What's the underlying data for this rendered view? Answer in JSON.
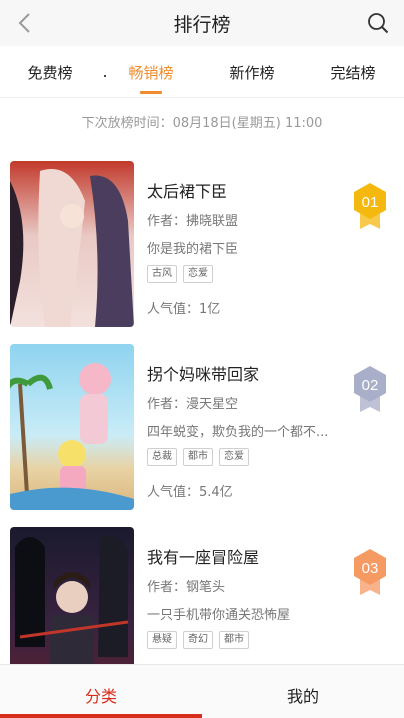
{
  "header": {
    "title": "排行榜",
    "back_icon": "chevron-left-icon",
    "search_icon": "search-icon"
  },
  "tabs": [
    {
      "label": "免费榜",
      "active": false
    },
    {
      "label": "畅销榜",
      "active": true
    },
    {
      "label": "新作榜",
      "active": false
    },
    {
      "label": "完结榜",
      "active": false
    }
  ],
  "schedule_text": "下次放榜时间：08月18日(星期五) 11:00",
  "items": [
    {
      "rank": "01",
      "title": "太后裙下臣",
      "author": "作者：拂晓联盟",
      "description": "你是我的裙下臣",
      "tags": [
        "古风",
        "恋爱"
      ],
      "popularity": "人气值：1亿",
      "badge_color": "#f5b80f"
    },
    {
      "rank": "02",
      "title": "拐个妈咪带回家",
      "author": "作者：漫天星空",
      "description": "四年蜕变，欺负我的一个都不...",
      "tags": [
        "总裁",
        "都市",
        "恋爱"
      ],
      "popularity": "人气值：5.4亿",
      "badge_color": "#a9aec9"
    },
    {
      "rank": "03",
      "title": "我有一座冒险屋",
      "author": "作者：钢笔头",
      "description": "一只手机带你通关恐怖屋",
      "tags": [
        "悬疑",
        "奇幻",
        "都市"
      ],
      "popularity": "",
      "badge_color": "#f59a63"
    }
  ],
  "bottom_nav": [
    {
      "label": "分类",
      "active": true
    },
    {
      "label": "我的",
      "active": false
    }
  ],
  "colors": {
    "accent": "#f08c2e",
    "nav_active": "#d72d1b"
  }
}
